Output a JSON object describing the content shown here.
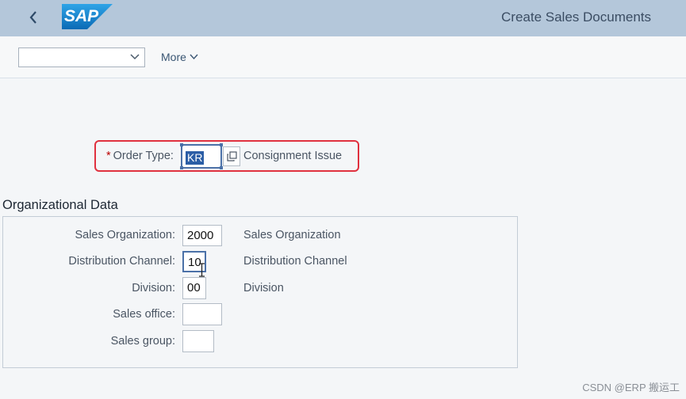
{
  "shellbar": {
    "logo_text": "SAP",
    "title": "Create Sales Documents",
    "brand_color": "#1b75bb"
  },
  "toolbar": {
    "variant_value": "",
    "more_label": "More"
  },
  "order": {
    "label": "Order Type:",
    "required_mark": "*",
    "value": "KR",
    "description": "Consignment Issue"
  },
  "org": {
    "title": "Organizational Data",
    "fields": [
      {
        "label": "Sales Organization:",
        "value": "2000",
        "description": "Sales Organization"
      },
      {
        "label": "Distribution Channel:",
        "value": "10",
        "description": "Distribution Channel"
      },
      {
        "label": "Division:",
        "value": "00",
        "description": "Division"
      },
      {
        "label": "Sales office:",
        "value": "",
        "description": ""
      },
      {
        "label": "Sales group:",
        "value": "",
        "description": ""
      }
    ]
  },
  "watermark": "CSDN @ERP 搬运工"
}
